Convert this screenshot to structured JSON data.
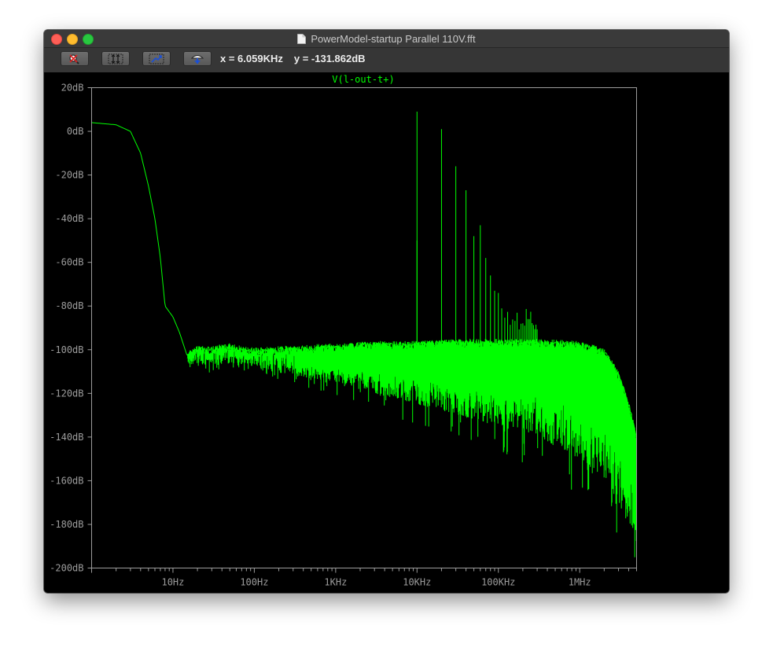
{
  "window": {
    "title": "PowerModel-startup Parallel 110V.fft"
  },
  "toolbar": {
    "buttons": [
      {
        "name": "zoom-cancel",
        "icon": "magnifier-cancel-icon"
      },
      {
        "name": "autorange-y",
        "icon": "autorange-y-icon"
      },
      {
        "name": "pan",
        "icon": "pan-icon"
      },
      {
        "name": "mark-reference",
        "icon": "marker-icon"
      }
    ],
    "cursor_x": "x = 6.059KHz",
    "cursor_y": "y = -131.862dB"
  },
  "colors": {
    "trace": "#00ff00",
    "background": "#000000",
    "axis": "#9c9c9c",
    "grid_frame": "#9c9c9c"
  },
  "chart_data": {
    "type": "line",
    "title": "V(l-out-t+)",
    "x_scale": "log",
    "xlim": [
      1,
      5000000
    ],
    "ylim": [
      -200,
      20
    ],
    "x_tick_labels": [
      "10Hz",
      "100Hz",
      "1KHz",
      "10KHz",
      "100KHz",
      "1MHz"
    ],
    "x_tick_values": [
      10,
      100,
      1000,
      10000,
      100000,
      1000000
    ],
    "y_tick_labels": [
      "20dB",
      "0dB",
      "-20dB",
      "-40dB",
      "-60dB",
      "-80dB",
      "-100dB",
      "-120dB",
      "-140dB",
      "-160dB",
      "-180dB",
      "-200dB"
    ],
    "y_tick_values": [
      20,
      0,
      -20,
      -40,
      -60,
      -80,
      -100,
      -120,
      -140,
      -160,
      -180,
      -200
    ],
    "series": [
      {
        "name": "V(l-out-t+)",
        "envelope_upper": [
          [
            1,
            4
          ],
          [
            2,
            3
          ],
          [
            3,
            0
          ],
          [
            4,
            -10
          ],
          [
            5,
            -25
          ],
          [
            6,
            -40
          ],
          [
            7,
            -58
          ],
          [
            8,
            -80
          ],
          [
            10,
            -85
          ],
          [
            12,
            -92
          ],
          [
            15,
            -103
          ],
          [
            20,
            -100
          ],
          [
            30,
            -100
          ],
          [
            50,
            -99
          ],
          [
            100,
            -101
          ],
          [
            300,
            -100
          ],
          [
            1000,
            -99
          ],
          [
            3000,
            -98
          ],
          [
            10000,
            -98
          ],
          [
            30000,
            -97
          ],
          [
            100000,
            -97
          ],
          [
            300000,
            -97
          ],
          [
            1000000,
            -98
          ],
          [
            2000000,
            -101
          ],
          [
            3000000,
            -112
          ],
          [
            4000000,
            -125
          ],
          [
            5000000,
            -140
          ]
        ],
        "envelope_lower": [
          [
            15,
            -106
          ],
          [
            20,
            -108
          ],
          [
            30,
            -108
          ],
          [
            50,
            -106
          ],
          [
            100,
            -108
          ],
          [
            300,
            -112
          ],
          [
            1000,
            -115
          ],
          [
            3000,
            -120
          ],
          [
            10000,
            -125
          ],
          [
            30000,
            -130
          ],
          [
            100000,
            -135
          ],
          [
            300000,
            -140
          ],
          [
            1000000,
            -150
          ],
          [
            2000000,
            -160
          ],
          [
            3000000,
            -172
          ],
          [
            5000000,
            -185
          ]
        ],
        "spikes": [
          [
            10000,
            9
          ],
          [
            10000,
            -50
          ],
          [
            20000,
            1
          ],
          [
            30000,
            -16
          ],
          [
            40000,
            -27
          ],
          [
            50000,
            -48
          ],
          [
            60000,
            -43
          ],
          [
            70000,
            -58
          ],
          [
            80000,
            -66
          ],
          [
            90000,
            -73
          ],
          [
            100000,
            -74
          ]
        ]
      }
    ]
  }
}
